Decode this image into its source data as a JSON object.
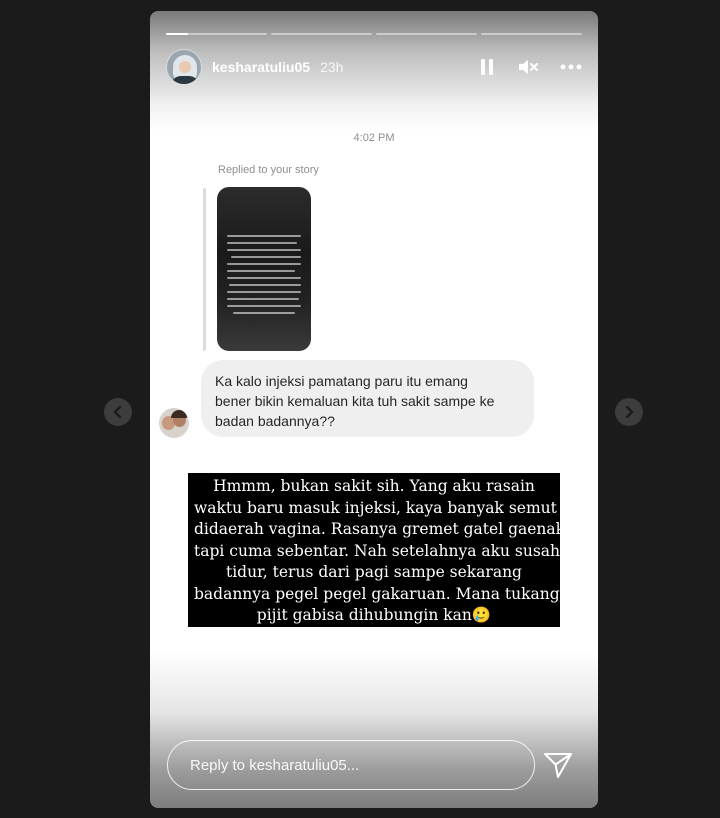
{
  "story": {
    "segments": 4,
    "progress": [
      0.22,
      0,
      0,
      0
    ],
    "username": "kesharatuliu05",
    "time_ago": "23h"
  },
  "icons": {
    "pause": "pause-icon",
    "mute": "volume-muted-icon",
    "more": "more-options-icon",
    "send": "send-icon",
    "prev": "chevron-left-icon",
    "next": "chevron-right-icon"
  },
  "dm": {
    "timestamp": "4:02 PM",
    "replied_label": "Replied to your story",
    "message_lines": [
      "Ka kalo injeksi pamatang paru itu emang",
      "bener bikin kemaluan kita tuh sakit sampe ke",
      "badan badannya??"
    ]
  },
  "caption": {
    "lines": [
      "Hmmm, bukan sakit sih. Yang aku rasain",
      "waktu baru masuk injeksi, kaya banyak semut",
      "didaerah vagina. Rasanya gremet gatel gaenak",
      "tapi cuma sebentar. Nah setelahnya aku susah",
      "tidur, terus dari pagi sampe sekarang",
      "badannya pegel pegel gakaruan. Mana tukang",
      "pijit gabisa dihubungin kan🥲"
    ]
  },
  "reply": {
    "placeholder": "Reply to kesharatuliu05..."
  },
  "colors": {
    "page_bg": "#1b1b1b",
    "bubble_bg": "#efefef",
    "meta_text": "#8e8e8e",
    "caption_bg": "#000000"
  }
}
